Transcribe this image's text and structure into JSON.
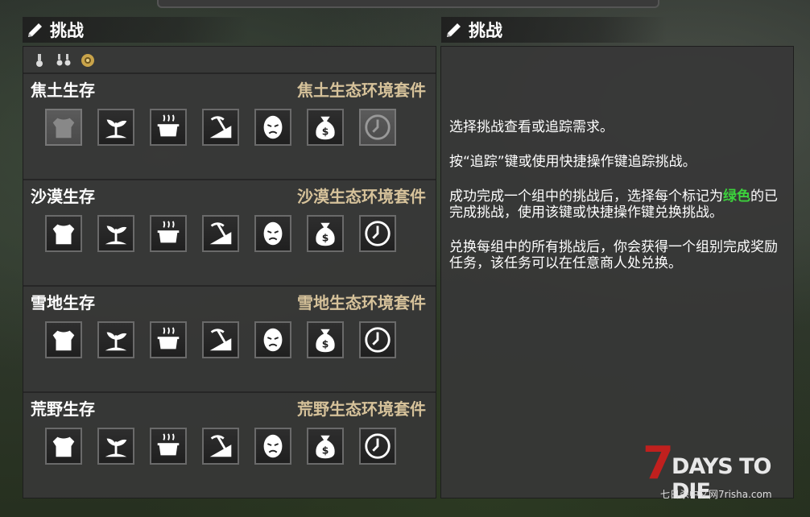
{
  "left_panel": {
    "title": "挑战",
    "filters": [
      "medal-single-icon",
      "medal-double-icon",
      "gear-badge-icon"
    ],
    "groups": [
      {
        "name": "焦土生存",
        "set": "焦土生态环境套件",
        "dimmed_first": true
      },
      {
        "name": "沙漠生存",
        "set": "沙漠生态环境套件",
        "dimmed_first": false
      },
      {
        "name": "雪地生存",
        "set": "雪地生态环境套件",
        "dimmed_first": false
      },
      {
        "name": "荒野生存",
        "set": "荒野生态环境套件",
        "dimmed_first": false
      }
    ],
    "challenge_icons": [
      "armor-icon",
      "sprout-icon",
      "cooking-pot-icon",
      "pickaxe-icon",
      "zombie-head-icon",
      "money-bag-icon",
      "clock-icon"
    ]
  },
  "right_panel": {
    "title": "挑战",
    "para1": "选择挑战查看或追踪需求。",
    "para2": "按“追踪”键或使用快捷操作键追踪挑战。",
    "para3_before": "成功完成一个组中的挑战后，选择每个标记为",
    "para3_green": "绿色",
    "para3_after": "的已完成挑战，使用该键或快捷操作键兑换挑战。",
    "para4": "兑换每组中的所有挑战后，你会获得一个组别完成奖励任务，该任务可以在任意商人处兑换。"
  },
  "logo": {
    "big": "7",
    "text": "DAYS TO DIE",
    "sub": "七日杀中文网7risha.com"
  },
  "colors": {
    "set_label": "#d6c29a",
    "green_text": "#3cd23c",
    "logo_red": "#c0201e"
  }
}
